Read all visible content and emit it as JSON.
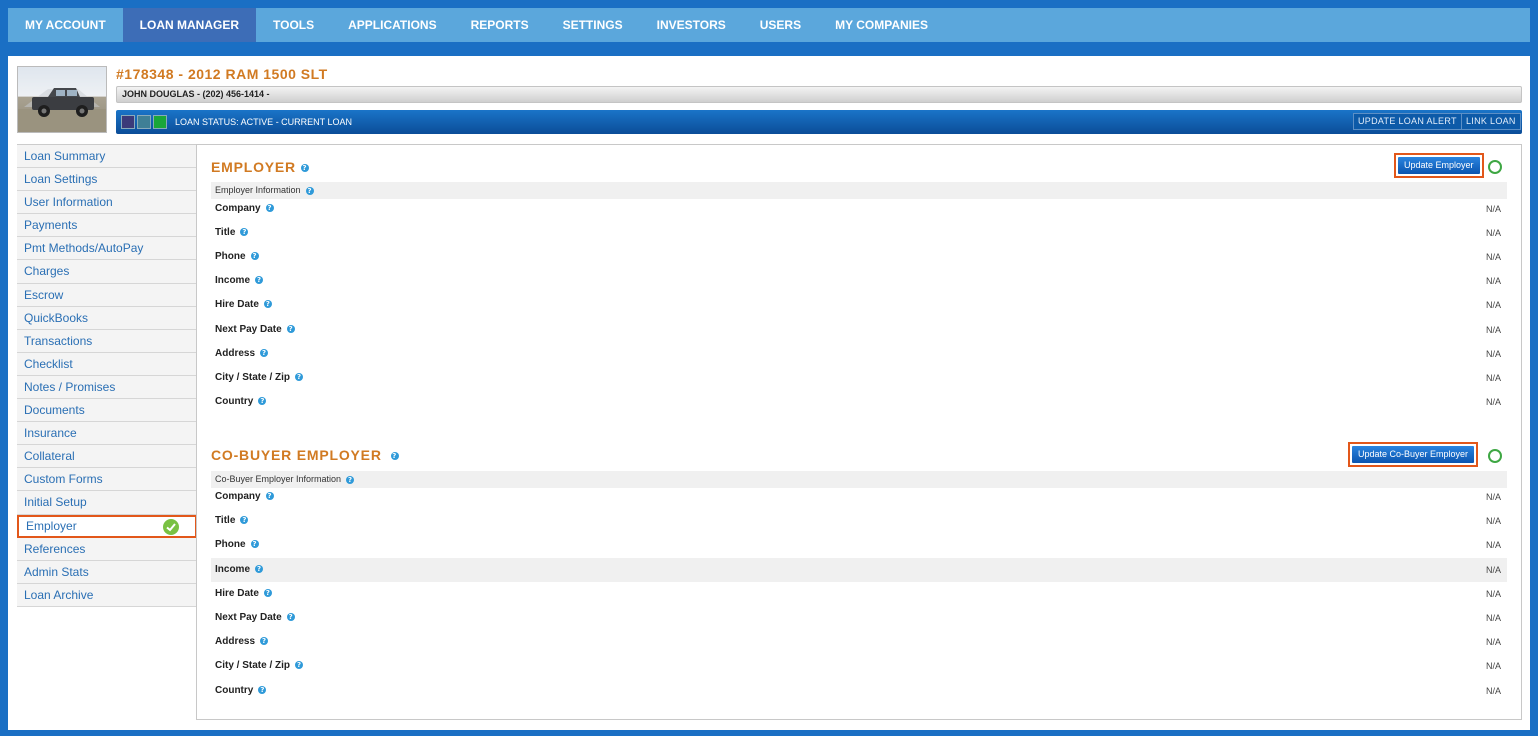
{
  "nav": {
    "items": [
      {
        "label": "MY ACCOUNT"
      },
      {
        "label": "LOAN MANAGER"
      },
      {
        "label": "TOOLS"
      },
      {
        "label": "APPLICATIONS"
      },
      {
        "label": "REPORTS"
      },
      {
        "label": "SETTINGS"
      },
      {
        "label": "INVESTORS"
      },
      {
        "label": "USERS"
      },
      {
        "label": "MY COMPANIES"
      }
    ],
    "active": "LOAN MANAGER"
  },
  "loan": {
    "title": "#178348 - 2012 RAM 1500 SLT",
    "borrower": "JOHN DOUGLAS - (202) 456-1414 -",
    "status": "LOAN STATUS: ACTIVE - CURRENT LOAN",
    "status_colors": [
      "#3b3a7a",
      "#3f7f96",
      "#1aa63a"
    ],
    "update_alert_label": "UPDATE LOAN ALERT",
    "link_loan_label": "LINK LOAN"
  },
  "sidebar": {
    "items": [
      {
        "label": "Loan Summary"
      },
      {
        "label": "Loan Settings"
      },
      {
        "label": "User Information"
      },
      {
        "label": "Payments"
      },
      {
        "label": "Pmt Methods/AutoPay"
      },
      {
        "label": "Charges"
      },
      {
        "label": "Escrow"
      },
      {
        "label": "QuickBooks"
      },
      {
        "label": "Transactions"
      },
      {
        "label": "Checklist"
      },
      {
        "label": "Notes / Promises"
      },
      {
        "label": "Documents"
      },
      {
        "label": "Insurance"
      },
      {
        "label": "Collateral"
      },
      {
        "label": "Custom Forms"
      },
      {
        "label": "Initial Setup"
      },
      {
        "label": "Employer"
      },
      {
        "label": "References"
      },
      {
        "label": "Admin Stats"
      },
      {
        "label": "Loan Archive"
      }
    ],
    "active": "Employer"
  },
  "employer": {
    "title": "EMPLOYER",
    "update_label": "Update Employer",
    "info_header": "Employer Information",
    "fields": [
      {
        "label": "Company",
        "value": "N/A"
      },
      {
        "label": "Title",
        "value": "N/A"
      },
      {
        "label": "Phone",
        "value": "N/A"
      },
      {
        "label": "Income",
        "value": "N/A"
      },
      {
        "label": "Hire Date",
        "value": "N/A"
      },
      {
        "label": "Next Pay Date",
        "value": "N/A"
      },
      {
        "label": "Address",
        "value": "N/A"
      },
      {
        "label": "City / State / Zip",
        "value": "N/A"
      },
      {
        "label": "Country",
        "value": "N/A"
      }
    ]
  },
  "cobuyer": {
    "title": "CO-BUYER EMPLOYER",
    "update_label": "Update Co-Buyer Employer",
    "info_header": "Co-Buyer Employer Information",
    "fields": [
      {
        "label": "Company",
        "value": "N/A"
      },
      {
        "label": "Title",
        "value": "N/A"
      },
      {
        "label": "Phone",
        "value": "N/A"
      },
      {
        "label": "Income",
        "value": "N/A"
      },
      {
        "label": "Hire Date",
        "value": "N/A"
      },
      {
        "label": "Next Pay Date",
        "value": "N/A"
      },
      {
        "label": "Address",
        "value": "N/A"
      },
      {
        "label": "City / State / Zip",
        "value": "N/A"
      },
      {
        "label": "Country",
        "value": "N/A"
      }
    ]
  },
  "colors": {
    "accent": "#d17a22",
    "highlight": "#e2571a",
    "nav_bg": "#5ba7dc",
    "link": "#2a6fb4"
  }
}
